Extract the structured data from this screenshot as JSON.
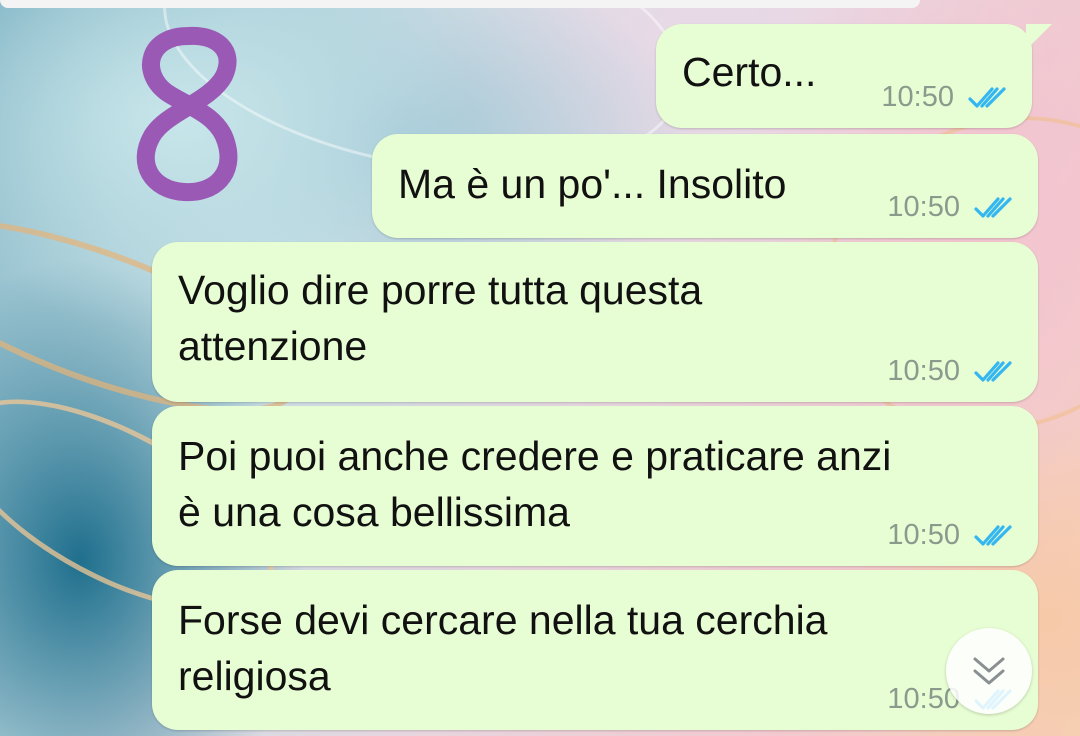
{
  "badge": {
    "label": "8",
    "color": "#9b59b6"
  },
  "messages": [
    {
      "text": "Certo...",
      "time": "10:50",
      "status": "read"
    },
    {
      "text": "Ma è un po'... Insolito",
      "time": "10:50",
      "status": "read"
    },
    {
      "text": "Voglio dire porre tutta questa\nattenzione",
      "time": "10:50",
      "status": "read"
    },
    {
      "text": "Poi puoi anche credere e praticare anzi\nè una cosa bellissima",
      "time": "10:50",
      "status": "read"
    },
    {
      "text": "Forse devi cercare nella tua cerchia\nreligiosa",
      "time": "10:50",
      "status": "read"
    }
  ],
  "colors": {
    "outgoing_bubble": "#e7fdd3",
    "read_ticks": "#34b7f1",
    "time_text": "#8a9a8d"
  },
  "icons": {
    "read_receipt": "double-check-icon",
    "scroll_down": "double-chevron-down-icon"
  }
}
